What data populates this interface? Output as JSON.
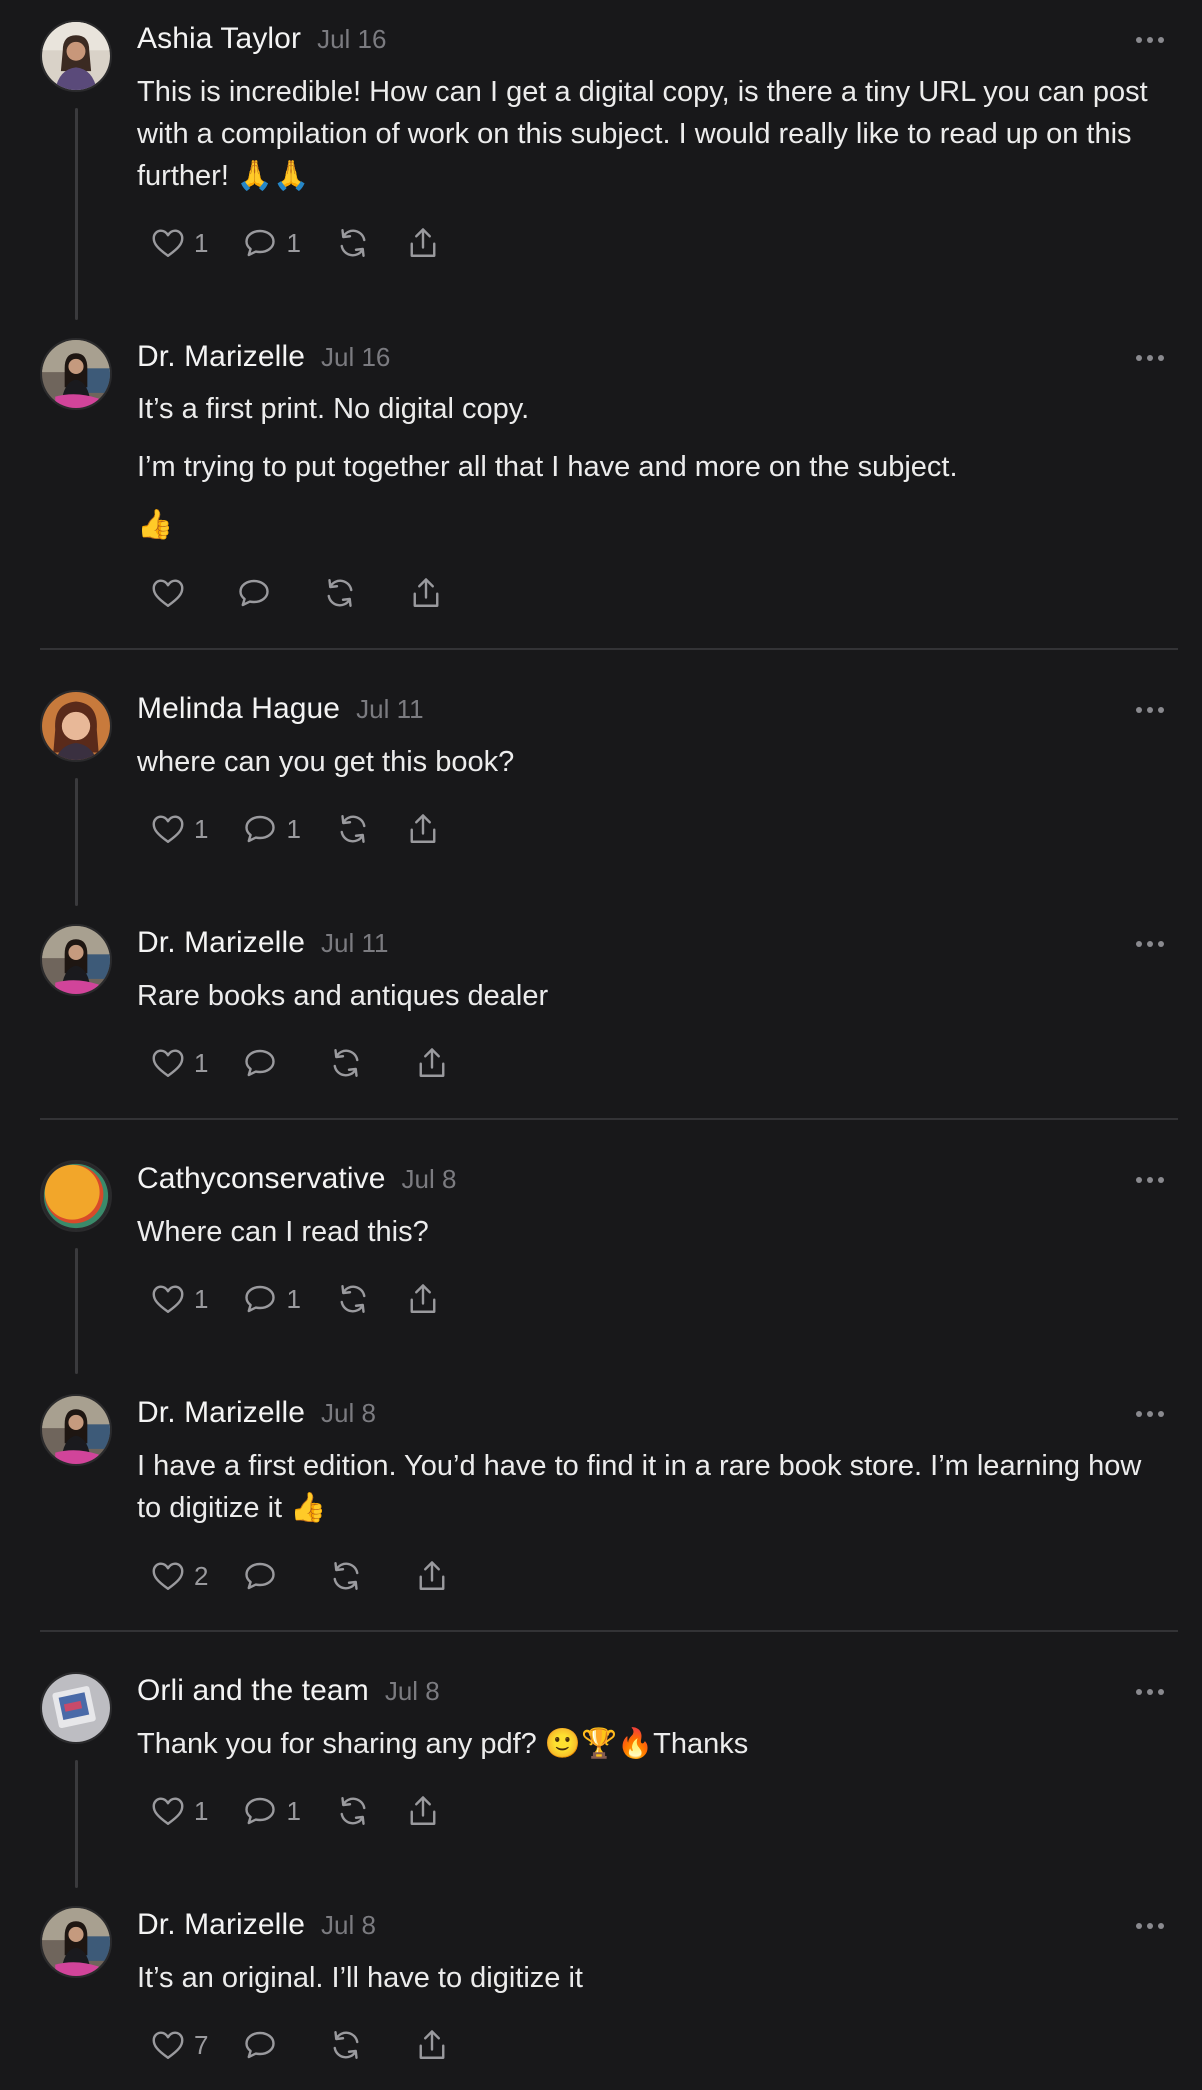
{
  "colors": {
    "background": "#18181a",
    "text": "#ececec",
    "muted": "#7b7b80",
    "divider": "#333336"
  },
  "icons": {
    "like": "heart-icon",
    "reply": "speech-bubble-icon",
    "repost": "repost-icon",
    "share": "share-icon",
    "more": "ellipsis-icon"
  },
  "comments": [
    {
      "author": "Ashia Taylor",
      "date": "Jul 16",
      "lines": [
        "This is incredible! How can I get a digital copy, is there a tiny URL you can post with a compilation of work on this subject. I would really like to read up on this further! 🙏🙏"
      ],
      "likes": "1",
      "replies": "1"
    },
    {
      "author": "Dr. Marizelle",
      "date": "Jul 16",
      "lines": [
        "It’s a first print. No digital copy.",
        "I’m trying to put together all that I have and more on the subject.",
        "👍"
      ],
      "likes": "",
      "replies": ""
    },
    {
      "author": "Melinda Hague",
      "date": "Jul 11",
      "lines": [
        "where can you get this book?"
      ],
      "likes": "1",
      "replies": "1"
    },
    {
      "author": "Dr. Marizelle",
      "date": "Jul 11",
      "lines": [
        "Rare books and antiques dealer"
      ],
      "likes": "1",
      "replies": ""
    },
    {
      "author": "Cathyconservative",
      "date": "Jul 8",
      "lines": [
        "Where can I read this?"
      ],
      "likes": "1",
      "replies": "1"
    },
    {
      "author": "Dr. Marizelle",
      "date": "Jul 8",
      "lines": [
        "I have a first edition. You’d have to find it in a rare book store. I’m learning how to digitize it 👍"
      ],
      "likes": "2",
      "replies": ""
    },
    {
      "author": "Orli and the team",
      "date": "Jul 8",
      "lines": [
        "Thank you for sharing any pdf? 🙂🏆🔥Thanks"
      ],
      "likes": "1",
      "replies": "1"
    },
    {
      "author": "Dr. Marizelle",
      "date": "Jul 8",
      "lines": [
        "It’s an original. I’ll have to digitize it"
      ],
      "likes": "7",
      "replies": ""
    }
  ]
}
